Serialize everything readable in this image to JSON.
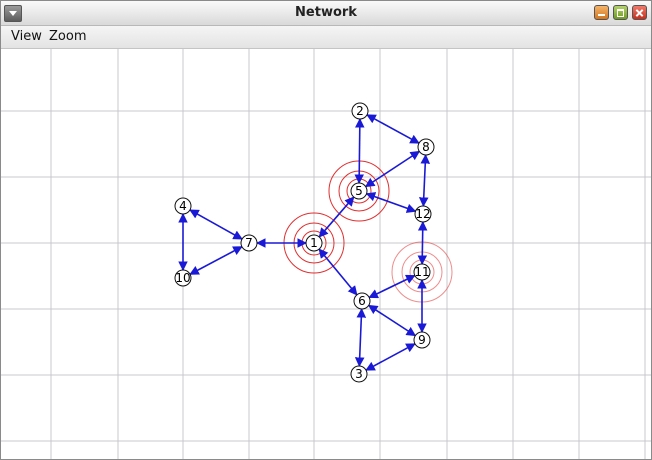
{
  "window": {
    "title": "Network"
  },
  "menu": {
    "items": [
      "View",
      "Zoom"
    ]
  },
  "graph": {
    "node_ids": [
      "1",
      "2",
      "3",
      "4",
      "5",
      "6",
      "7",
      "8",
      "9",
      "10",
      "11",
      "12"
    ],
    "edges": [
      [
        "2",
        "5"
      ],
      [
        "2",
        "8"
      ],
      [
        "8",
        "5"
      ],
      [
        "8",
        "12"
      ],
      [
        "5",
        "12"
      ],
      [
        "5",
        "1"
      ],
      [
        "1",
        "6"
      ],
      [
        "12",
        "11"
      ],
      [
        "11",
        "6"
      ],
      [
        "11",
        "9"
      ],
      [
        "6",
        "9"
      ],
      [
        "6",
        "3"
      ],
      [
        "9",
        "3"
      ],
      [
        "7",
        "4"
      ],
      [
        "7",
        "10"
      ],
      [
        "10",
        "4"
      ],
      [
        "7",
        "1"
      ]
    ],
    "highlighted_nodes": [
      "5",
      "1",
      "11"
    ]
  }
}
